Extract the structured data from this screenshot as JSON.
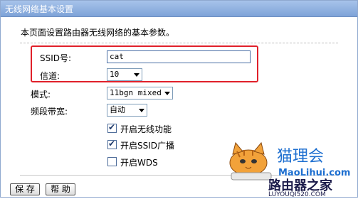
{
  "title": "无线网络基本设置",
  "intro": "本页面设置路由器无线网络的基本参数。",
  "fields": {
    "ssid_label": "SSID号:",
    "ssid_value": "cat",
    "channel_label": "信道:",
    "channel_value": "10",
    "mode_label": "模式:",
    "mode_value": "11bgn mixed",
    "bandwidth_label": "频段带宽:",
    "bandwidth_value": "自动"
  },
  "checkboxes": [
    {
      "label": "开启无线功能",
      "checked": true
    },
    {
      "label": "开启SSID广播",
      "checked": true
    },
    {
      "label": "开启WDS",
      "checked": false
    }
  ],
  "buttons": {
    "save": "保 存",
    "help": "帮 助"
  },
  "watermark": {
    "brand_cn": "猫理会",
    "brand_url": "MaoLihui.com",
    "brand2_cn": "路由器之家",
    "brand2_url": "LUYOUQI520.COM"
  },
  "colors": {
    "titlebar": "#8fb0e0",
    "highlight_box": "#e0202a",
    "watermark_blue": "#1e6fd0",
    "watermark_dark": "#1b1b4a"
  }
}
